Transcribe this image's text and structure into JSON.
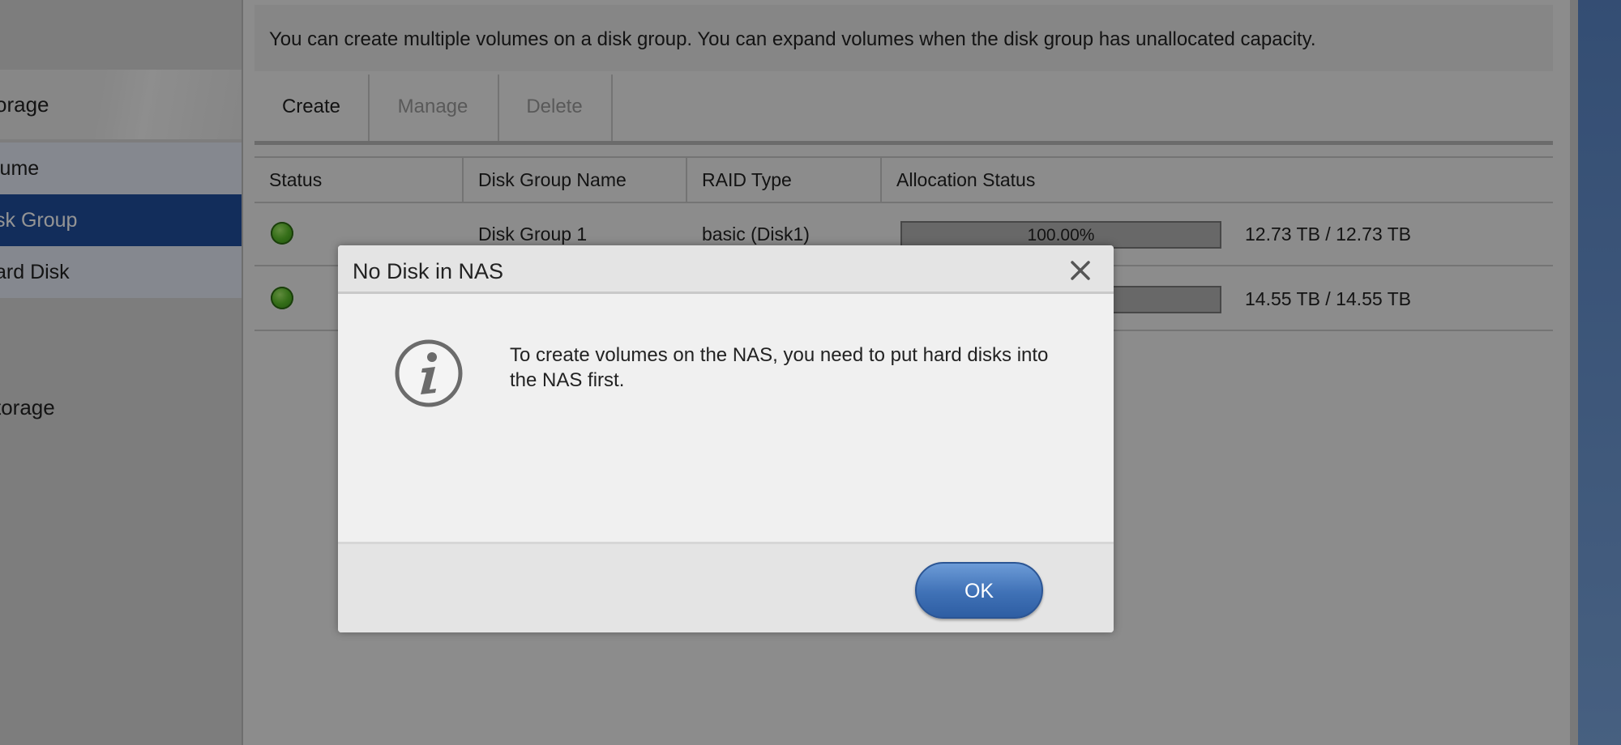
{
  "sidebar": {
    "header": "orage",
    "items": [
      {
        "label": "lume",
        "active": false
      },
      {
        "label": "sk Group",
        "active": true
      },
      {
        "label": "ard Disk",
        "active": false
      }
    ],
    "section": "torage"
  },
  "info_text": "You can create multiple volumes on a disk group. You can expand volumes when the disk group has unallocated capacity.",
  "toolbar": {
    "create_label": "Create",
    "manage_label": "Manage",
    "delete_label": "Delete"
  },
  "grid": {
    "headers": [
      "Status",
      "Disk Group Name",
      "RAID Type",
      "Allocation Status"
    ],
    "rows": [
      {
        "status": "green",
        "name": "Disk Group 1",
        "raid": "basic (Disk1)",
        "allocation_percent": 100,
        "allocation_text": "100.00%",
        "capacity": "12.73 TB / 12.73 TB"
      },
      {
        "status": "green",
        "name": "",
        "raid": "",
        "allocation_percent": 100,
        "allocation_text": "",
        "capacity": "14.55 TB / 14.55 TB"
      }
    ]
  },
  "dialog": {
    "title": "No Disk in NAS",
    "message": "To create volumes on the NAS, you need to put hard disks into the NAS first.",
    "ok_label": "OK",
    "icon": "info-icon"
  },
  "colors": {
    "sidebar_active": "#1f4f9e",
    "ok_button": "#3f71b6",
    "status_green": "#5cbf2b"
  }
}
